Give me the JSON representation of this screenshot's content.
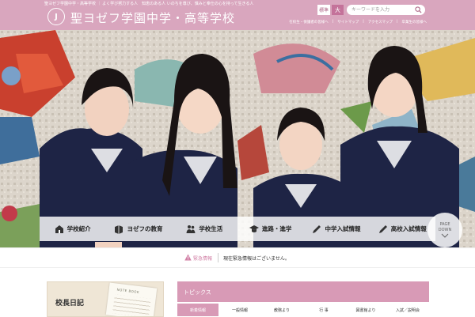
{
  "header": {
    "tagline": "聖ヨゼフ学園中学・高等学校 ｜ よく学び努力する人　知恵のある人 いのちを尊び、慎みと奉仕の心を持って生きる人",
    "logo_text": "J",
    "site_title": "聖ヨゼフ学園中学・高等学校",
    "text_size_standard": "標準",
    "text_size_large": "大",
    "search_placeholder": "キーワードを入力",
    "util_links": [
      "在校生・保護者の皆様へ",
      "サイトマップ",
      "アクセスマップ",
      "卒業生の皆様へ"
    ]
  },
  "nav": {
    "items": [
      {
        "label": "学校紹介",
        "icon": "school-building-icon"
      },
      {
        "label": "ヨゼフの教育",
        "icon": "book-icon"
      },
      {
        "label": "学校生活",
        "icon": "students-icon"
      },
      {
        "label": "進路・進学",
        "icon": "graduation-icon"
      },
      {
        "label": "中学入試情報",
        "icon": "pencil-icon"
      },
      {
        "label": "高校入試情報",
        "icon": "pencil-icon"
      }
    ]
  },
  "page_down": {
    "line1": "PAGE",
    "line2": "DOWN"
  },
  "alert": {
    "label": "緊急情報",
    "text": "現在緊急情報はございません。"
  },
  "diary": {
    "label": "校長日記",
    "book_title": "NOTE BOOK"
  },
  "topics": {
    "title": "トピックス",
    "tabs": [
      "新着情報",
      "一般情報",
      "教務より",
      "行 事",
      "図書館より",
      "入試／説明会"
    ],
    "active_tab": 0
  },
  "colors": {
    "brand_pink": "#d9a6be",
    "accent_pink": "#c4729a",
    "topics_pink": "#d89ab6"
  }
}
